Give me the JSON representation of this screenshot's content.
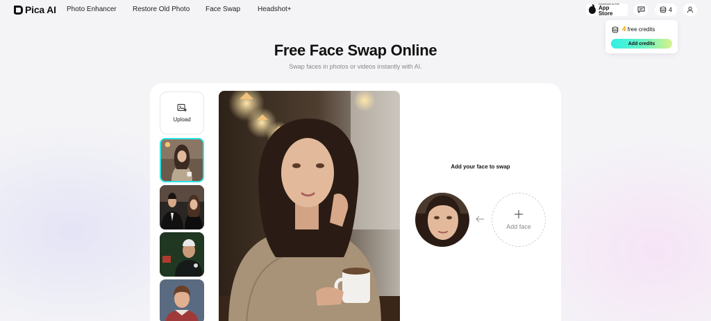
{
  "brand": {
    "name": "Pica AI"
  },
  "nav": {
    "links": [
      "Photo Enhancer",
      "Restore Old Photo",
      "Face Swap",
      "Headshot+"
    ]
  },
  "header": {
    "appstore_small": "Download on the",
    "appstore_big": "App Store",
    "credit_count": "4"
  },
  "credits_popup": {
    "count": "4",
    "label": "free credits",
    "button": "Add credits"
  },
  "hero": {
    "title": "Free Face Swap Online",
    "subtitle": "Swap faces in photos or videos instantly with AI."
  },
  "sidebar": {
    "upload_label": "Upload"
  },
  "swap": {
    "title": "Add your face to swap",
    "add_face_label": "Add face"
  },
  "colors": {
    "accent_cyan": "#2fe3e6",
    "credit_orange": "#f5a000"
  },
  "icons": {
    "chat": "chat-icon",
    "credits": "coins-stack-icon",
    "user": "user-icon",
    "upload": "image-upload-icon",
    "arrow": "arrow-left-icon",
    "add": "plus-icon"
  }
}
